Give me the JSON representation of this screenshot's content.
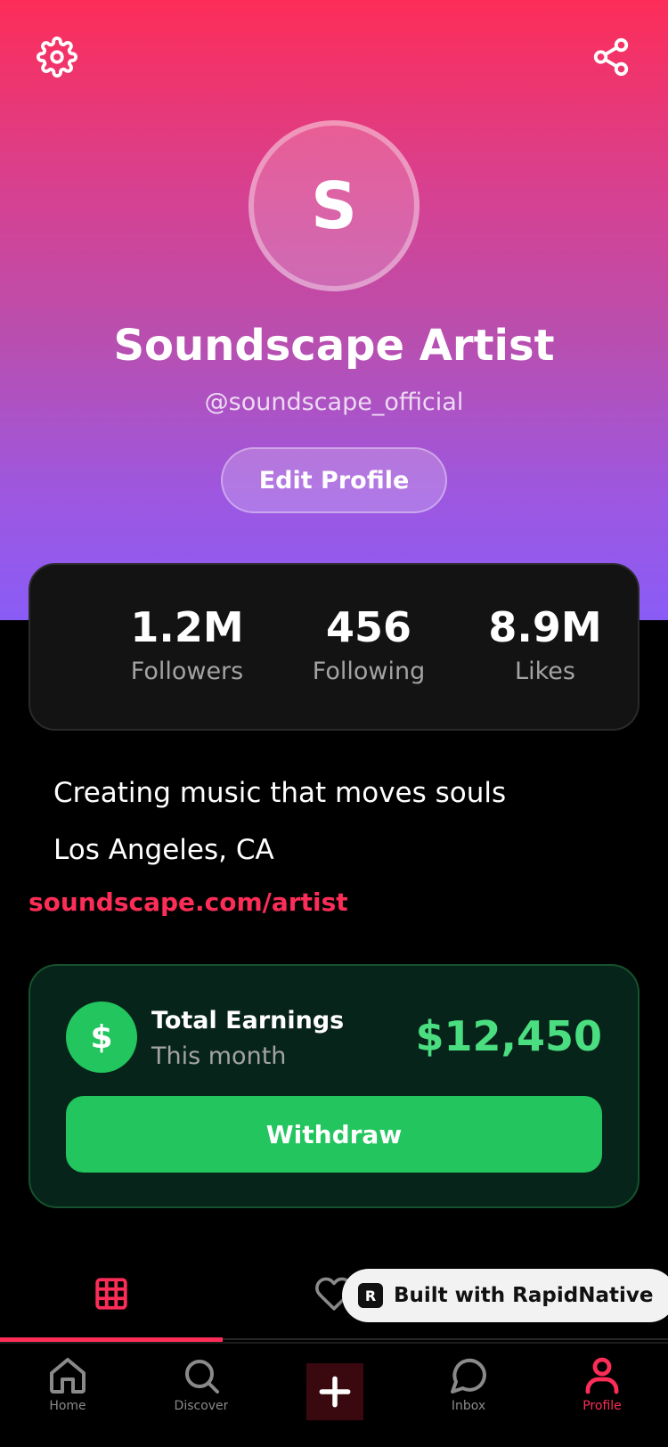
{
  "profile": {
    "avatar_letter": "S",
    "display_name": "Soundscape Artist",
    "handle": "@soundscape_official",
    "edit_label": "Edit Profile"
  },
  "stats": [
    {
      "value": "1.2M",
      "label": "Followers"
    },
    {
      "value": "456",
      "label": "Following"
    },
    {
      "value": "8.9M",
      "label": "Likes"
    }
  ],
  "about": {
    "bio": "Creating music that moves souls",
    "location": "Los Angeles, CA",
    "website": "soundscape.com/artist"
  },
  "earnings": {
    "currency_symbol": "$",
    "title": "Total Earnings",
    "period": "This month",
    "amount": "$12,450",
    "withdraw_label": "Withdraw"
  },
  "tabs": [
    {
      "icon": "grid-icon",
      "active": true
    },
    {
      "icon": "heart-icon",
      "active": false
    }
  ],
  "badge": {
    "logo_letter": "R",
    "text": "Built with RapidNative"
  },
  "nav": {
    "items": [
      {
        "icon": "home-icon",
        "label": "Home",
        "active": false
      },
      {
        "icon": "search-icon",
        "label": "Discover",
        "active": false
      },
      {
        "icon": "plus-icon",
        "label": "",
        "active": false
      },
      {
        "icon": "chat-icon",
        "label": "Inbox",
        "active": false
      },
      {
        "icon": "user-icon",
        "label": "Profile",
        "active": true
      }
    ]
  },
  "colors": {
    "accent": "#fd2d58",
    "money_green": "#22c55e",
    "money_text": "#4ade80",
    "gradient_top": "#fd2d58",
    "gradient_bottom": "#8a5cf6"
  }
}
